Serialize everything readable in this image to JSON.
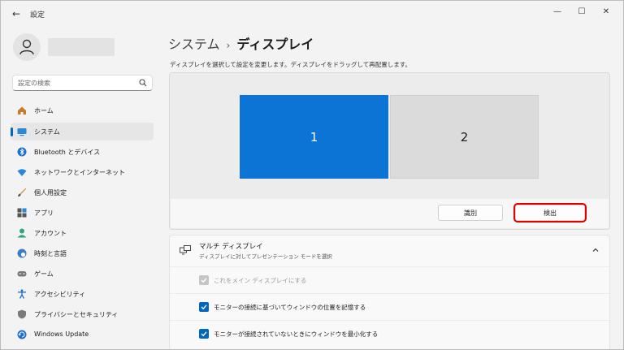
{
  "window": {
    "title": "設定",
    "back_glyph": "←",
    "minimize_glyph": "—",
    "maximize_glyph": "☐",
    "close_glyph": "✕"
  },
  "sidebar": {
    "search_placeholder": "設定の検索",
    "items": [
      {
        "label": "ホーム",
        "icon": "home-icon"
      },
      {
        "label": "システム",
        "icon": "system-icon",
        "active": true
      },
      {
        "label": "Bluetooth とデバイス",
        "icon": "bluetooth-icon"
      },
      {
        "label": "ネットワークとインターネット",
        "icon": "wifi-icon"
      },
      {
        "label": "個人用設定",
        "icon": "brush-icon"
      },
      {
        "label": "アプリ",
        "icon": "apps-icon"
      },
      {
        "label": "アカウント",
        "icon": "account-icon"
      },
      {
        "label": "時刻と言語",
        "icon": "globe-clock-icon"
      },
      {
        "label": "ゲーム",
        "icon": "gamepad-icon"
      },
      {
        "label": "アクセシビリティ",
        "icon": "accessibility-icon"
      },
      {
        "label": "プライバシーとセキュリティ",
        "icon": "shield-icon"
      },
      {
        "label": "Windows Update",
        "icon": "update-icon"
      }
    ]
  },
  "main": {
    "breadcrumb_parent": "システム",
    "breadcrumb_sep": "›",
    "breadcrumb_current": "ディスプレイ",
    "hint": "ディスプレイを選択して設定を変更します。ディスプレイをドラッグして再配置します。",
    "monitors": [
      {
        "label": "1",
        "selected": true
      },
      {
        "label": "2",
        "selected": false
      }
    ],
    "identify_label": "識別",
    "detect_label": "検出",
    "multi_display": {
      "title": "マルチ ディスプレイ",
      "subtitle": "ディスプレイに対してプレゼンテーション モードを選択",
      "expanded": true,
      "options": [
        {
          "label": "これをメイン ディスプレイにする",
          "checked": true,
          "disabled": true
        },
        {
          "label": "モニターの接続に基づいてウィンドウの位置を記憶する",
          "checked": true,
          "disabled": false
        },
        {
          "label": "モニターが接続されていないときにウィンドウを最小化する",
          "checked": true,
          "disabled": false
        }
      ]
    }
  },
  "colors": {
    "accent": "#0067c0",
    "selected_monitor": "#0b74d4",
    "highlight_border": "#e00000"
  }
}
